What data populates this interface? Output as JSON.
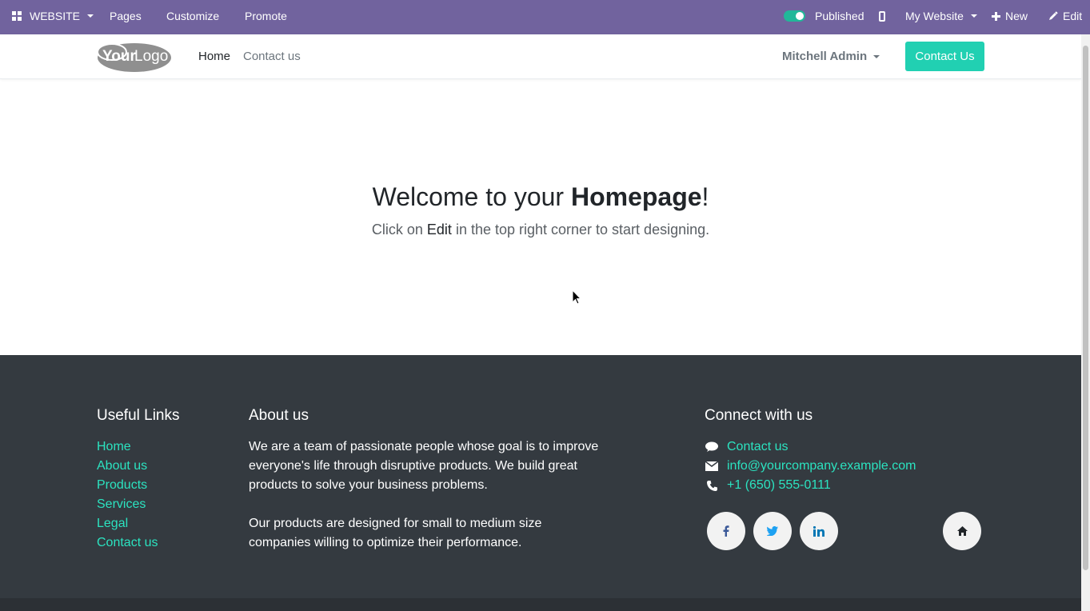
{
  "adminbar": {
    "website_label": "WEBSITE",
    "pages_label": "Pages",
    "customize_label": "Customize",
    "promote_label": "Promote",
    "published_label": "Published",
    "site_label": "My Website",
    "new_label": "New",
    "edit_label": "Edit"
  },
  "header": {
    "logo_text_1": "Your",
    "logo_text_2": "Logo",
    "nav": [
      "Home",
      "Contact us"
    ],
    "user": "Mitchell Admin",
    "cta": "Contact Us"
  },
  "hero": {
    "title_prefix": "Welcome to your ",
    "title_bold": "Homepage",
    "title_suffix": "!",
    "sub_prefix": "Click on ",
    "sub_bold": "Edit",
    "sub_suffix": " in the top right corner to start designing."
  },
  "footer": {
    "useful_title": "Useful Links",
    "useful_links": [
      "Home",
      "About us",
      "Products",
      "Services",
      "Legal",
      "Contact us"
    ],
    "about_title": "About us",
    "about_p1_lines": [
      "We are a team of passionate people whose goal is to improve",
      "everyone's life through disruptive products. We build great",
      "products to solve your business problems."
    ],
    "about_p2_lines": [
      "Our products are designed for small to medium size",
      "companies willing to optimize their performance."
    ],
    "connect_title": "Connect with us",
    "contact_link": "Contact us",
    "email": "info@yourcompany.example.com",
    "phone": "+1 (650) 555-0111",
    "social_icons": [
      "facebook-icon",
      "twitter-icon",
      "linkedin-icon",
      "home-icon"
    ]
  },
  "colors": {
    "admin_bar": "#71639e",
    "accent": "#21d0b2",
    "footer_bg": "#343a40",
    "footer_link": "#2be3c0"
  }
}
